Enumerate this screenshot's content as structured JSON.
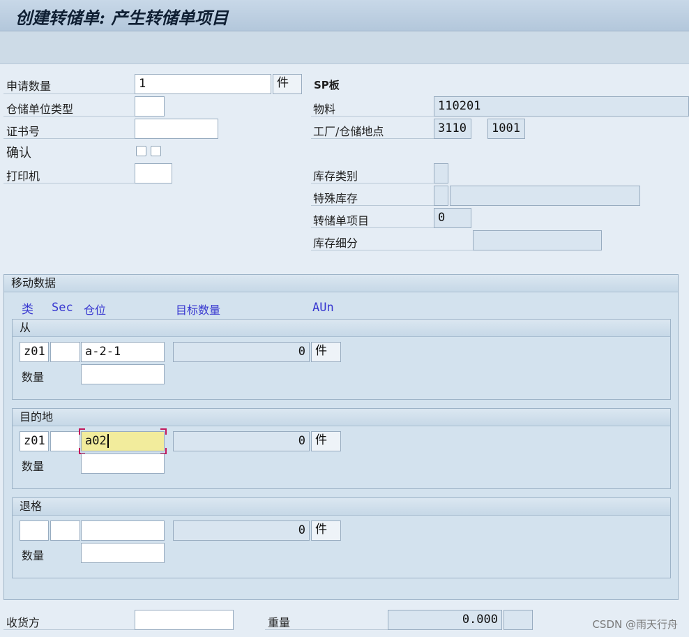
{
  "title": "创建转储单: 产生转储单项目",
  "header_form": {
    "req_qty_label": "申请数量",
    "req_qty_value": "1",
    "req_qty_unit": "件",
    "su_type_label": "仓储单位类型",
    "cert_label": "证书号",
    "confirm_label": "确认",
    "printer_label": "打印机",
    "material_desc": "SP板",
    "material_label": "物料",
    "material_value": "110201",
    "plant_label": "工厂/仓储地点",
    "plant_value": "3110",
    "storage_loc_value": "1001",
    "stock_cat_label": "库存类别",
    "special_stock_label": "特殊库存",
    "to_item_label": "转储单项目",
    "to_item_value": "0",
    "stock_subdiv_label": "库存细分"
  },
  "movement": {
    "group_title": "移动数据",
    "columns": {
      "type": "类",
      "sec": "Sec",
      "bin": "仓位",
      "target_qty": "目标数量",
      "aun": "AUn"
    },
    "qty_label": "数量",
    "from": {
      "title": "从",
      "type": "z01",
      "sec": "",
      "bin": "a-2-1",
      "target_qty": "0",
      "unit": "件"
    },
    "dest": {
      "title": "目的地",
      "type": "z01",
      "sec": "",
      "bin": "a02",
      "target_qty": "0",
      "unit": "件"
    },
    "return": {
      "title": "退格",
      "type": "",
      "sec": "",
      "bin": "",
      "target_qty": "0",
      "unit": "件"
    }
  },
  "footer": {
    "recipient_label": "收货方",
    "weight_label": "重量",
    "weight_value": "0.000"
  },
  "watermark": "CSDN @雨天行舟"
}
